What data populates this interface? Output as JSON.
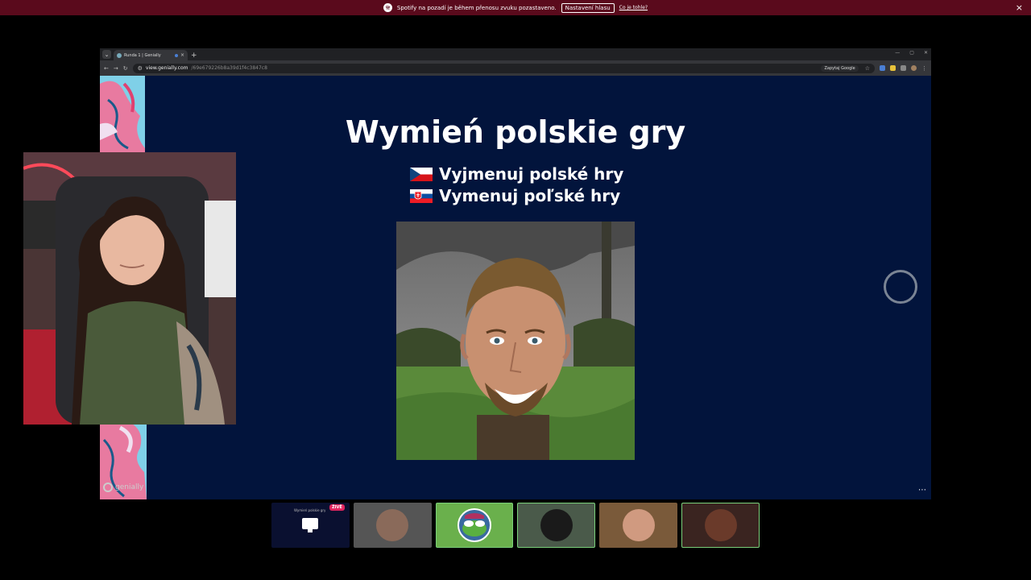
{
  "notification": {
    "message": "Spotify na pozadí je během přenosu zvuku pozastaveno.",
    "button_label": "Nastavení hlasu",
    "link_label": "Co je tohle?",
    "close_glyph": "×"
  },
  "browser": {
    "tab_title": "Runda 1 | Genially",
    "new_tab_glyph": "+",
    "tab_close_glyph": "×",
    "url_host": "view.genially.com",
    "url_path": "/69e679226b8a39d1f4c3847c8",
    "ask_google_label": "Zapytaj Google",
    "window_controls": [
      "—",
      "▢",
      "✕"
    ]
  },
  "slide": {
    "title": "Wymień polskie gry",
    "lines": [
      {
        "flag": "cz",
        "text": "Vyjmenuj polské hry"
      },
      {
        "flag": "sk",
        "text": "Vymenuj poľské hry"
      }
    ],
    "brand": "genially",
    "more_glyph": "⋯"
  },
  "participants": {
    "live_badge": "ŽIVĚ",
    "mini_title": "Wymień polskie gry",
    "tiles": [
      {
        "kind": "screen",
        "active": false
      },
      {
        "kind": "person",
        "active": false,
        "color": "#6b6b6b"
      },
      {
        "kind": "pepe",
        "active": true,
        "color": "#6ab04c"
      },
      {
        "kind": "seal",
        "active": true,
        "color": "#4a5a4a"
      },
      {
        "kind": "person",
        "active": false,
        "color": "#7a5a3a"
      },
      {
        "kind": "character",
        "active": true,
        "color": "#3a2420"
      }
    ]
  },
  "colors": {
    "notification_bg": "#5a0a1c",
    "slide_bg": "#02143c",
    "active_border": "#7ad07a",
    "live_badge": "#e0245e"
  }
}
